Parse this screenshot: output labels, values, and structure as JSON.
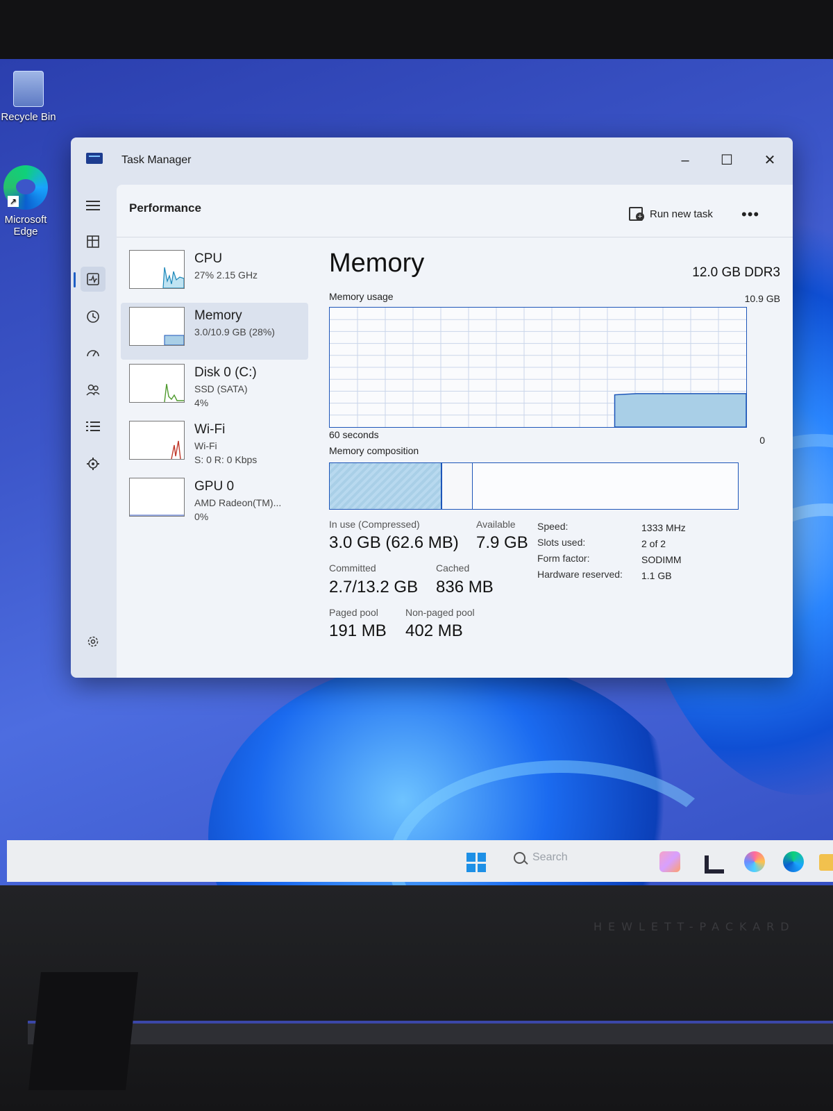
{
  "desktop": {
    "icons": [
      {
        "label": "Recycle Bin"
      },
      {
        "label": "Microsoft Edge"
      }
    ],
    "brand": "HEWLETT-PACKARD"
  },
  "taskbar": {
    "search_placeholder": "Search"
  },
  "window": {
    "title": "Task Manager",
    "controls": {
      "minimize": "–",
      "maximize": "☐",
      "close": "✕"
    },
    "page_title": "Performance",
    "run_new_task": "Run new task",
    "more": "•••"
  },
  "perf_items": [
    {
      "name": "CPU",
      "sub1": "27% 2.15 GHz",
      "sub2": ""
    },
    {
      "name": "Memory",
      "sub1": "3.0/10.9 GB (28%)",
      "sub2": ""
    },
    {
      "name": "Disk 0 (C:)",
      "sub1": "SSD (SATA)",
      "sub2": "4%"
    },
    {
      "name": "Wi-Fi",
      "sub1": "Wi-Fi",
      "sub2": "S: 0 R: 0 Kbps"
    },
    {
      "name": "GPU 0",
      "sub1": "AMD Radeon(TM)...",
      "sub2": "0%"
    }
  ],
  "memory": {
    "title": "Memory",
    "spec": "12.0 GB DDR3",
    "usage_label": "Memory usage",
    "usage_max": "10.9 GB",
    "axis_left": "60 seconds",
    "axis_right": "0",
    "composition_label": "Memory composition",
    "usage_history_fraction": [
      0,
      0,
      0,
      0,
      0,
      0,
      0,
      0,
      0,
      0,
      0,
      0,
      0,
      0.27,
      0.28,
      0.28,
      0.28,
      0.28,
      0.28,
      0.28
    ],
    "composition": {
      "in_use_fraction": 0.275,
      "modified_fraction": 0.075
    },
    "stats": {
      "in_use_label": "In use (Compressed)",
      "in_use_value": "3.0 GB (62.6 MB)",
      "available_label": "Available",
      "available_value": "7.9 GB",
      "committed_label": "Committed",
      "committed_value": "2.7/13.2 GB",
      "cached_label": "Cached",
      "cached_value": "836 MB",
      "paged_label": "Paged pool",
      "paged_value": "191 MB",
      "nonpaged_label": "Non-paged pool",
      "nonpaged_value": "402 MB"
    },
    "specs": [
      {
        "label": "Speed:",
        "value": "1333 MHz"
      },
      {
        "label": "Slots used:",
        "value": "2 of 2"
      },
      {
        "label": "Form factor:",
        "value": "SODIMM"
      },
      {
        "label": "Hardware reserved:",
        "value": "1.1 GB"
      }
    ]
  },
  "colors": {
    "accent": "#1c55b8",
    "graph_fill": "#a9cfe7"
  }
}
